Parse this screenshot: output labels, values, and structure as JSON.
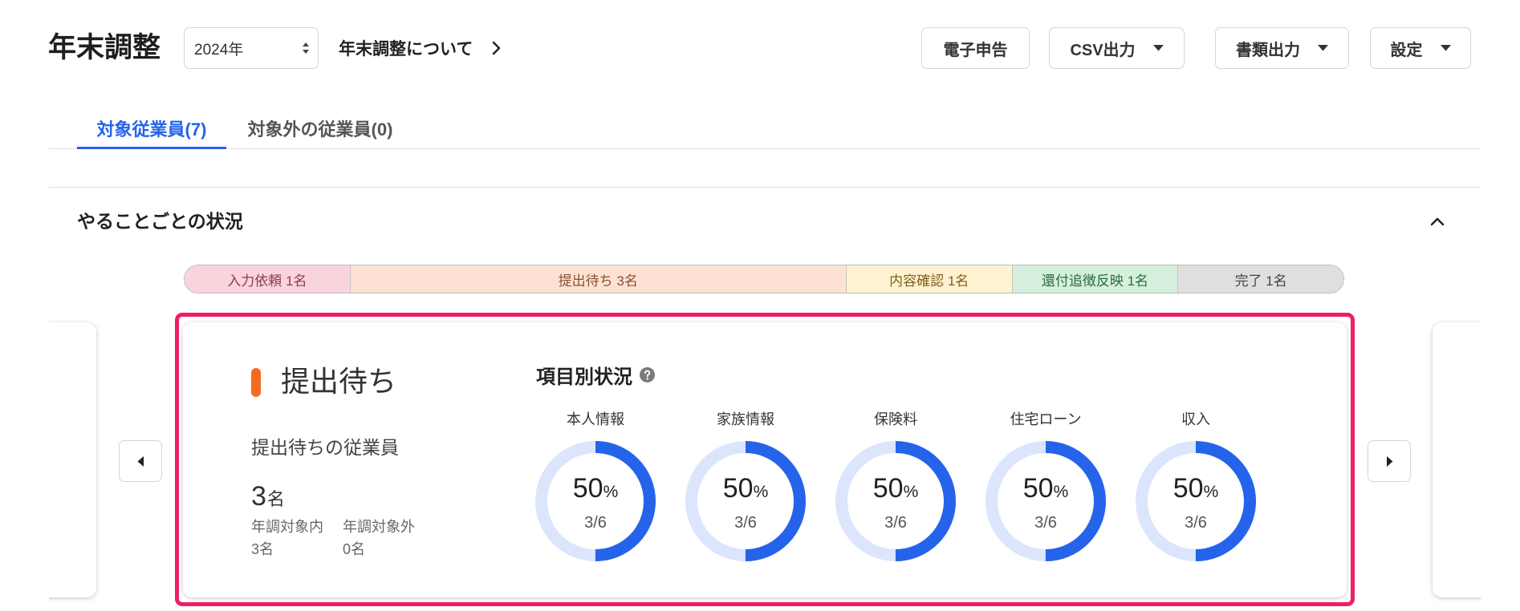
{
  "header": {
    "title": "年末調整",
    "year_select": {
      "value": "2024年"
    },
    "about_link": {
      "label": "年末調整について"
    },
    "buttons": {
      "e_filing": {
        "label": "電子申告"
      },
      "csv_export": {
        "label": "CSV出力"
      },
      "document_export": {
        "label": "書類出力"
      },
      "settings": {
        "label": "設定"
      }
    }
  },
  "tabs": [
    {
      "label": "対象従業員(7)",
      "active": true
    },
    {
      "label": "対象外の従業員(0)",
      "active": false
    }
  ],
  "status_section": {
    "title": "やることごとの状況",
    "expanded": true,
    "segments": [
      {
        "label": "入力依頼 1名",
        "count": 1,
        "bg": "#f9d4dd",
        "fg": "#8e3a4e"
      },
      {
        "label": "提出待ち 3名",
        "count": 3,
        "bg": "#fde2d4",
        "fg": "#8b4f30"
      },
      {
        "label": "内容確認 1名",
        "count": 1,
        "bg": "#fff2d0",
        "fg": "#80601f"
      },
      {
        "label": "還付追徴反映 1名",
        "count": 1,
        "bg": "#d4f0dd",
        "fg": "#2d6b40"
      },
      {
        "label": "完了 1名",
        "count": 1,
        "bg": "#dfdfdf",
        "fg": "#444444"
      }
    ]
  },
  "status_card": {
    "title": "提出待ち",
    "accent_color": "#f26b1f",
    "employees_label": "提出待ちの従業員",
    "employee_count": "3",
    "employee_unit": "名",
    "breakdown": [
      {
        "label": "年調対象内",
        "value": "3名"
      },
      {
        "label": "年調対象外",
        "value": "0名"
      }
    ],
    "items_title": "項目別状況",
    "percent_unit": "%",
    "items": [
      {
        "label": "本人情報",
        "percent": 50,
        "fraction": "3/6"
      },
      {
        "label": "家族情報",
        "percent": 50,
        "fraction": "3/6"
      },
      {
        "label": "保険料",
        "percent": 50,
        "fraction": "3/6"
      },
      {
        "label": "住宅ローン",
        "percent": 50,
        "fraction": "3/6"
      },
      {
        "label": "収入",
        "percent": 50,
        "fraction": "3/6"
      }
    ]
  },
  "colors": {
    "primary": "#2563eb",
    "ring_track": "#dbe6fd",
    "highlight": "#ee1f66"
  },
  "icons": {
    "year_select": "select-arrows-icon",
    "about_link": "chevron-right-icon",
    "dropdown": "caret-down-icon",
    "collapse": "chevron-up-icon",
    "help": "help-icon",
    "prev": "caret-left-icon",
    "next": "caret-right-icon"
  }
}
